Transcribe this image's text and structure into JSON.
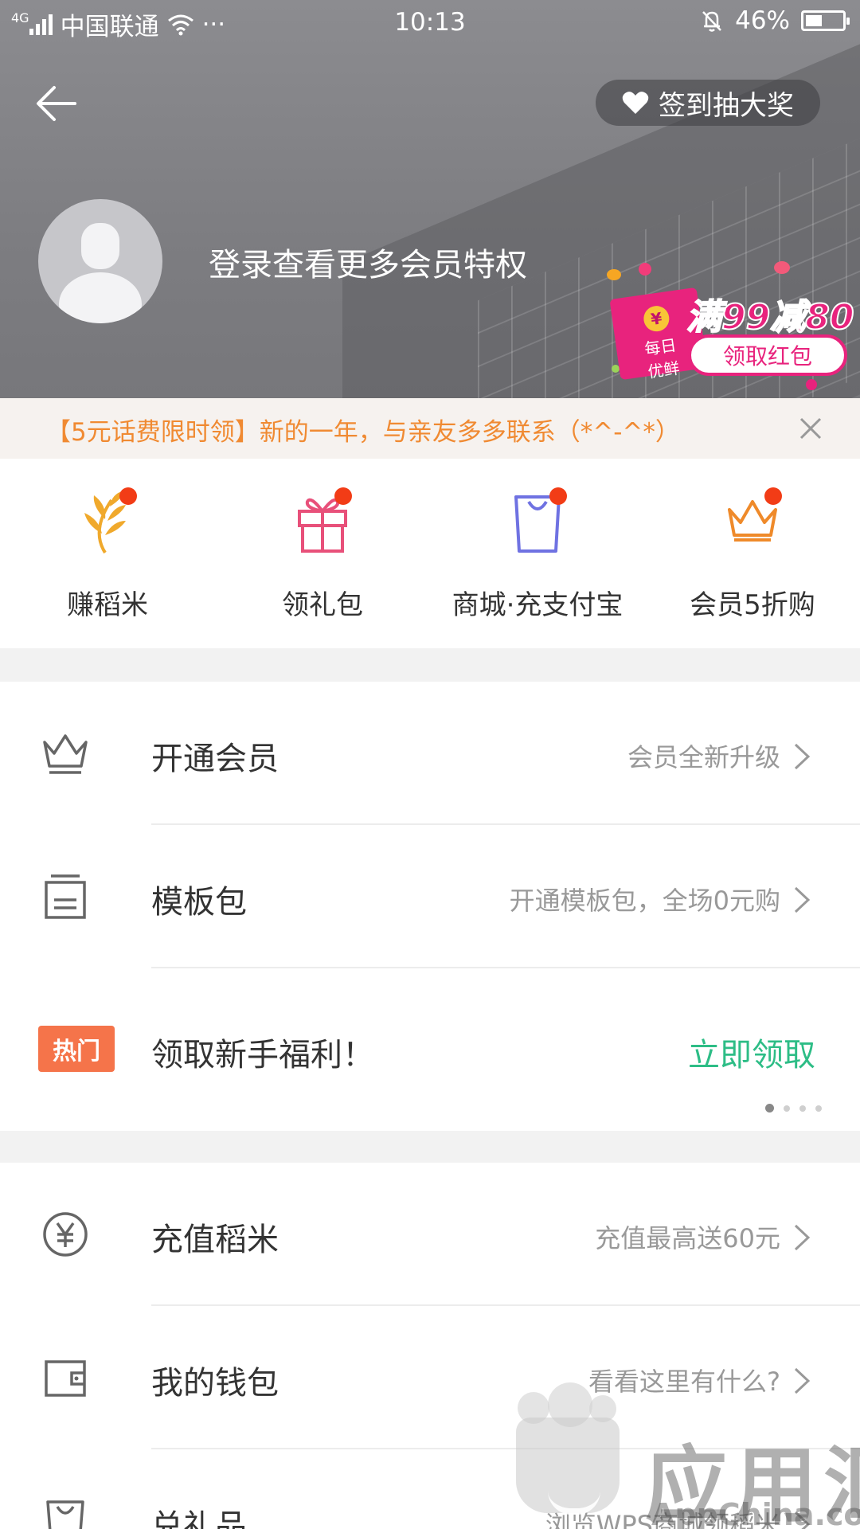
{
  "status_bar": {
    "network": "4G",
    "carrier": "中国联通",
    "more": "···",
    "time": "10:13",
    "battery": "46%",
    "battery_level": 0.46
  },
  "header": {
    "checkin_label": "签到抽大奖",
    "login_prompt": "登录查看更多会员特权",
    "promo": {
      "card_text_line1": "每日",
      "card_text_line2": "优鲜",
      "coin": "¥",
      "headline": "满99减80",
      "button_label": "领取红包"
    }
  },
  "notice": {
    "text": "【5元话费限时领】新的一年，与亲友多多联系（*^-^*）"
  },
  "tiles": [
    {
      "label": "赚稻米",
      "icon": "wheat-icon",
      "color": "#f0a92c"
    },
    {
      "label": "领礼包",
      "icon": "gift-icon",
      "color": "#e8507a"
    },
    {
      "label": "商城·充支付宝",
      "icon": "shopping-bag-icon",
      "color": "#6f72e2"
    },
    {
      "label": "会员5折购",
      "icon": "crown-icon",
      "color": "#ef8a2a"
    }
  ],
  "section1": {
    "rows": [
      {
        "title": "开通会员",
        "sub": "会员全新升级",
        "icon": "crown-outline-icon"
      },
      {
        "title": "模板包",
        "sub": "开通模板包，全场0元购",
        "icon": "template-icon"
      }
    ],
    "hot_row": {
      "badge": "热门",
      "title": "领取新手福利！",
      "action": "立即领取"
    }
  },
  "section2": {
    "rows": [
      {
        "title": "充值稻米",
        "sub": "充值最高送60元",
        "icon": "yen-coin-icon"
      },
      {
        "title": "我的钱包",
        "sub": "看看这里有什么?",
        "icon": "wallet-icon"
      },
      {
        "title": "兑礼品",
        "sub": "浏览WPS商城领稻米",
        "icon": "bag-outline-icon"
      }
    ]
  },
  "watermark": {
    "cn": "应用汇",
    "en": "AppChina.com"
  },
  "colors": {
    "accent_orange": "#f08a32",
    "accent_green": "#2dbd86",
    "hot_badge": "#f5744a",
    "promo_pink": "#e8237d",
    "badge_red": "#f23c16"
  }
}
